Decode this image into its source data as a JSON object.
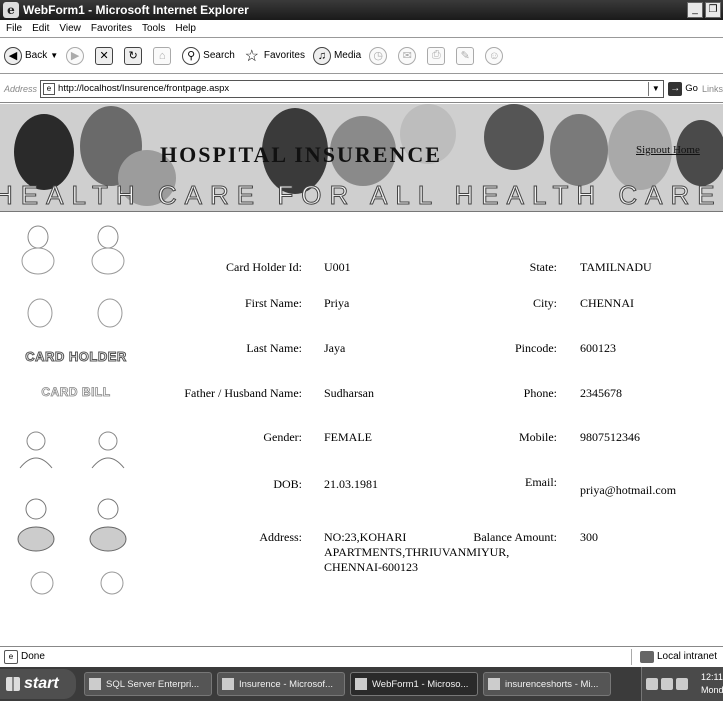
{
  "window": {
    "title": "WebForm1 - Microsoft Internet Explorer",
    "logo": "e"
  },
  "menu": [
    "File",
    "Edit",
    "View",
    "Favorites",
    "Tools",
    "Help"
  ],
  "toolbar": {
    "back": "Back",
    "search": "Search",
    "favorites": "Favorites",
    "media": "Media"
  },
  "address": {
    "label": "Address",
    "url": "http://localhost/Insurence/frontpage.aspx",
    "go": "Go",
    "links": "Links"
  },
  "banner": {
    "header_text": "HOSPITAL INSURENCE",
    "signout": "Signout  Home",
    "strip_text": "HEALTH CARE FOR ALL   HEALTH CARE FOR ALL HEALTH"
  },
  "nav": {
    "card_holder": "CARD HOLDER",
    "card_bill": "CARD BILL"
  },
  "record": {
    "card_holder_id_label": "Card Holder Id:",
    "card_holder_id": "U001",
    "first_name_label": "First Name:",
    "first_name": "Priya",
    "last_name_label": "Last Name:",
    "last_name": "Jaya",
    "father_label": "Father / Husband Name:",
    "father": "Sudharsan",
    "gender_label": "Gender:",
    "gender": "FEMALE",
    "dob_label": "DOB:",
    "dob": "21.03.1981",
    "address_label": "Address:",
    "address": "NO:23,KOHARI APARTMENTS,THRIUVANMIYUR, CHENNAI-600123",
    "state_label": "State:",
    "state": "TAMILNADU",
    "city_label": "City:",
    "city": "CHENNAI",
    "pincode_label": "Pincode:",
    "pincode": "600123",
    "phone_label": "Phone:",
    "phone": "2345678",
    "mobile_label": "Mobile:",
    "mobile": "9807512346",
    "email_label": "Email:",
    "email": "priya@hotmail.com",
    "balance_label": "Balance Amount:",
    "balance": "300"
  },
  "status": {
    "text": "Done",
    "zone": "Local intranet"
  },
  "taskbar": {
    "start": "start",
    "tasks": [
      "SQL Server Enterpri...",
      "Insurence - Microsof...",
      "WebForm1 - Microso...",
      "insurenceshorts - Mi..."
    ],
    "clock_time": "12:11 P",
    "clock_day": "Monda"
  }
}
